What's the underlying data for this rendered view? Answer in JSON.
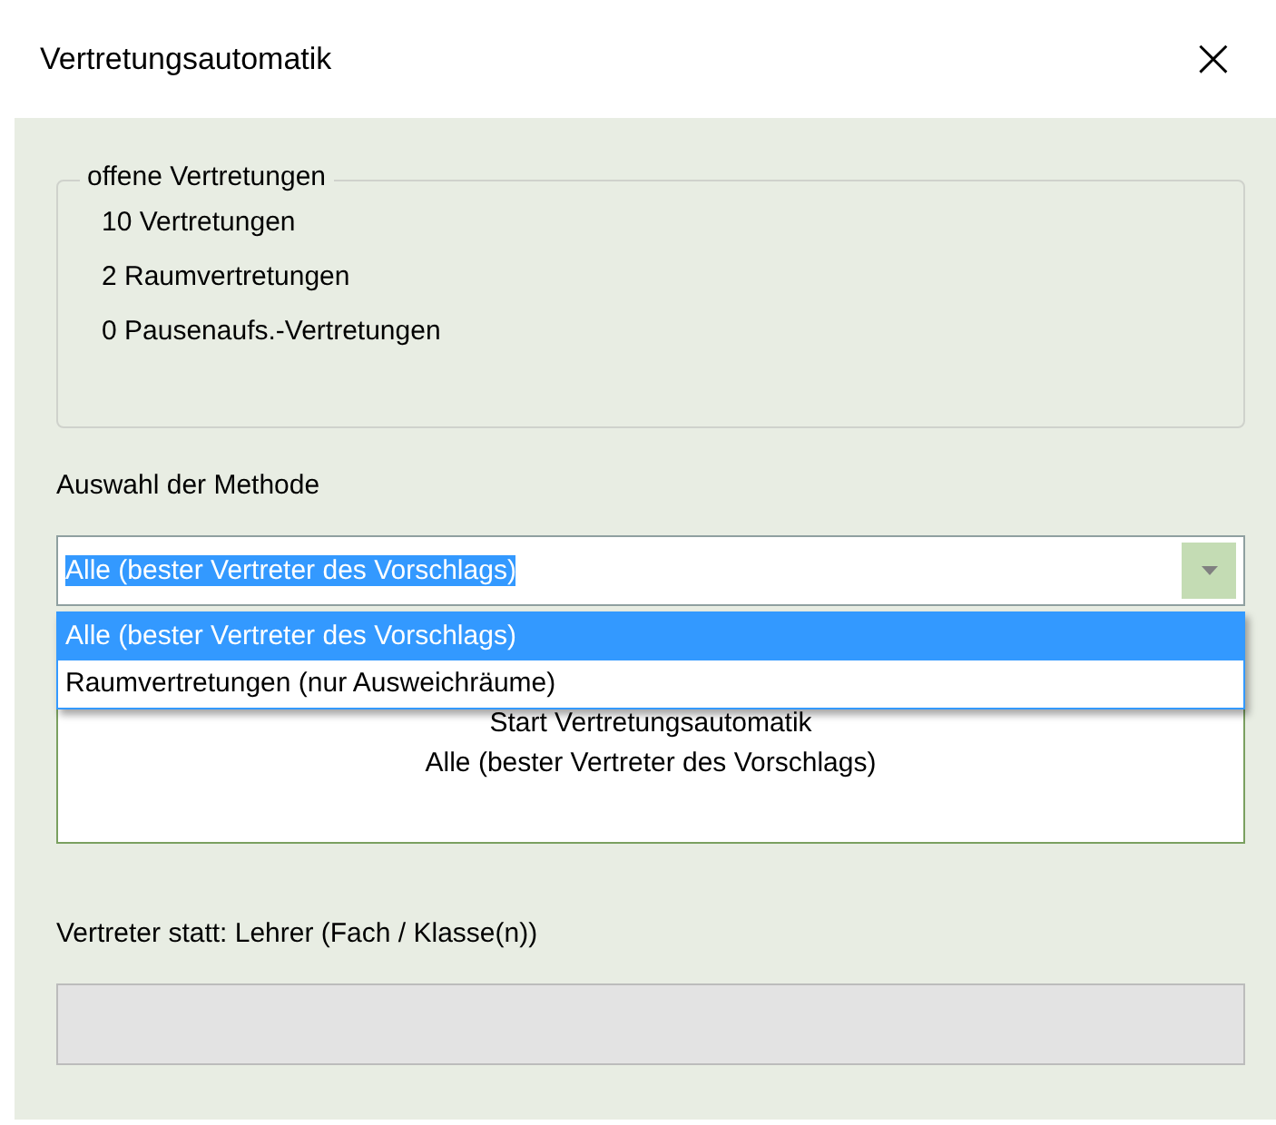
{
  "window": {
    "title": "Vertretungsautomatik",
    "close": "×"
  },
  "open_group": {
    "legend": "offene Vertretungen",
    "lines": [
      "10 Vertretungen",
      "2 Raumvertretungen",
      "0 Pausenaufs.-Vertretungen"
    ]
  },
  "method": {
    "label": "Auswahl der Methode",
    "value": "Alle (bester Vertreter des Vorschlags)",
    "expanded": true,
    "options": [
      {
        "label": "Alle (bester Vertreter des Vorschlags)",
        "selected": true
      },
      {
        "label": "Raumvertretungen (nur Ausweichräume)",
        "selected": false
      }
    ]
  },
  "start_button": {
    "lines": [
      "Start Vertretungsautomatik",
      "Alle (bester Vertreter des Vorschlags)"
    ]
  },
  "status_label": "Vertreter statt: Lehrer (Fach / Klasse(n))",
  "progress": {
    "level": 0
  }
}
